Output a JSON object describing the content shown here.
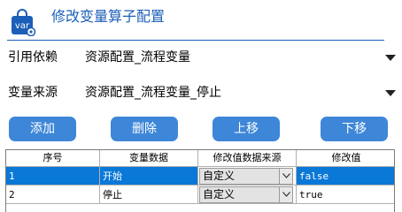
{
  "window": {
    "title": "修改变量算子配置",
    "icon": "shopping-bag-var-icon",
    "icon_text": "var",
    "accent": "#1c5fb8"
  },
  "fields": {
    "dependency": {
      "label": "引用依赖",
      "value": "资源配置_流程变量"
    },
    "source": {
      "label": "变量来源",
      "value": "资源配置_流程变量_停止"
    }
  },
  "buttons": {
    "add": "添加",
    "delete": "删除",
    "move_up": "上移",
    "move_down": "下移",
    "color": "#3d86d8"
  },
  "table": {
    "headers": [
      "序号",
      "变量数据",
      "修改值数据来源",
      "修改值"
    ],
    "rows": [
      {
        "index": "1",
        "variable": "开始",
        "source": "自定义",
        "value": "false",
        "selected": true
      },
      {
        "index": "2",
        "variable": "停止",
        "source": "自定义",
        "value": "true",
        "selected": false
      }
    ],
    "selection_color": "#0a78d7"
  }
}
